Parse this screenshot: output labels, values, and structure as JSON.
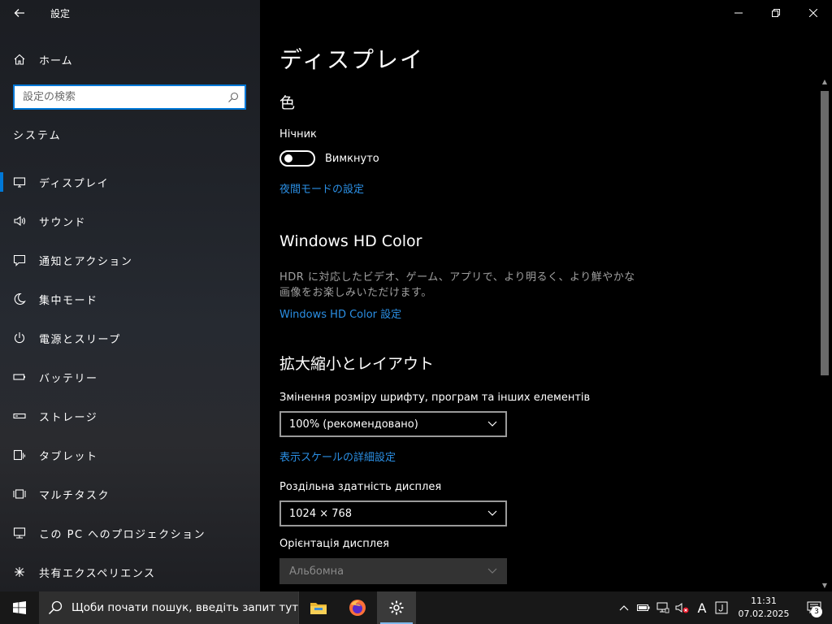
{
  "window": {
    "title": "設定"
  },
  "sidebar": {
    "home_label": "ホーム",
    "search_placeholder": "設定の検索",
    "section_title": "システム",
    "items": [
      {
        "label": "ディスプレイ",
        "icon": "monitor-icon",
        "active": true
      },
      {
        "label": "サウンド",
        "icon": "speaker-icon"
      },
      {
        "label": "通知とアクション",
        "icon": "notification-icon"
      },
      {
        "label": "集中モード",
        "icon": "moon-icon"
      },
      {
        "label": "電源とスリープ",
        "icon": "power-icon"
      },
      {
        "label": "バッテリー",
        "icon": "battery-icon"
      },
      {
        "label": "ストレージ",
        "icon": "storage-icon"
      },
      {
        "label": "タブレット",
        "icon": "tablet-icon"
      },
      {
        "label": "マルチタスク",
        "icon": "multitask-icon"
      },
      {
        "label": "この PC へのプロジェクション",
        "icon": "projection-icon"
      },
      {
        "label": "共有エクスペリエンス",
        "icon": "share-icon"
      }
    ]
  },
  "main": {
    "page_title": "ディスプレイ",
    "color_heading": "色",
    "night_light_label": "Нічник",
    "night_light_state": "Вимкнуто",
    "night_light_link": "夜間モードの設定",
    "hd_heading": "Windows HD Color",
    "hd_desc_line1": "HDR に対応したビデオ、ゲーム、アプリで、より明るく、より鮮やかな",
    "hd_desc_line2": "画像をお楽しみいただけます。",
    "hd_link": "Windows HD Color 設定",
    "layout_heading": "拡大縮小とレイアウト",
    "scale_label": "Змінення розміру шрифту, програм та інших елементів",
    "scale_value": "100% (рекомендовано)",
    "scale_link": "表示スケールの詳細設定",
    "resolution_label": "Роздільна здатність дисплея",
    "resolution_value": "1024 × 768",
    "orientation_label": "Орієнтація дисплея",
    "orientation_value": "Альбомна"
  },
  "taskbar": {
    "search_placeholder": "Щоби почати пошук, введіть запит тут",
    "apps": [
      "file-explorer-icon",
      "firefox-icon",
      "settings-icon"
    ],
    "tray_ime": "A",
    "clock_time": "11:31",
    "clock_date": "07.02.2025",
    "notification_count": "3"
  },
  "colors": {
    "accent": "#0078d7",
    "link": "#2b8fe4",
    "background": "#000000"
  }
}
